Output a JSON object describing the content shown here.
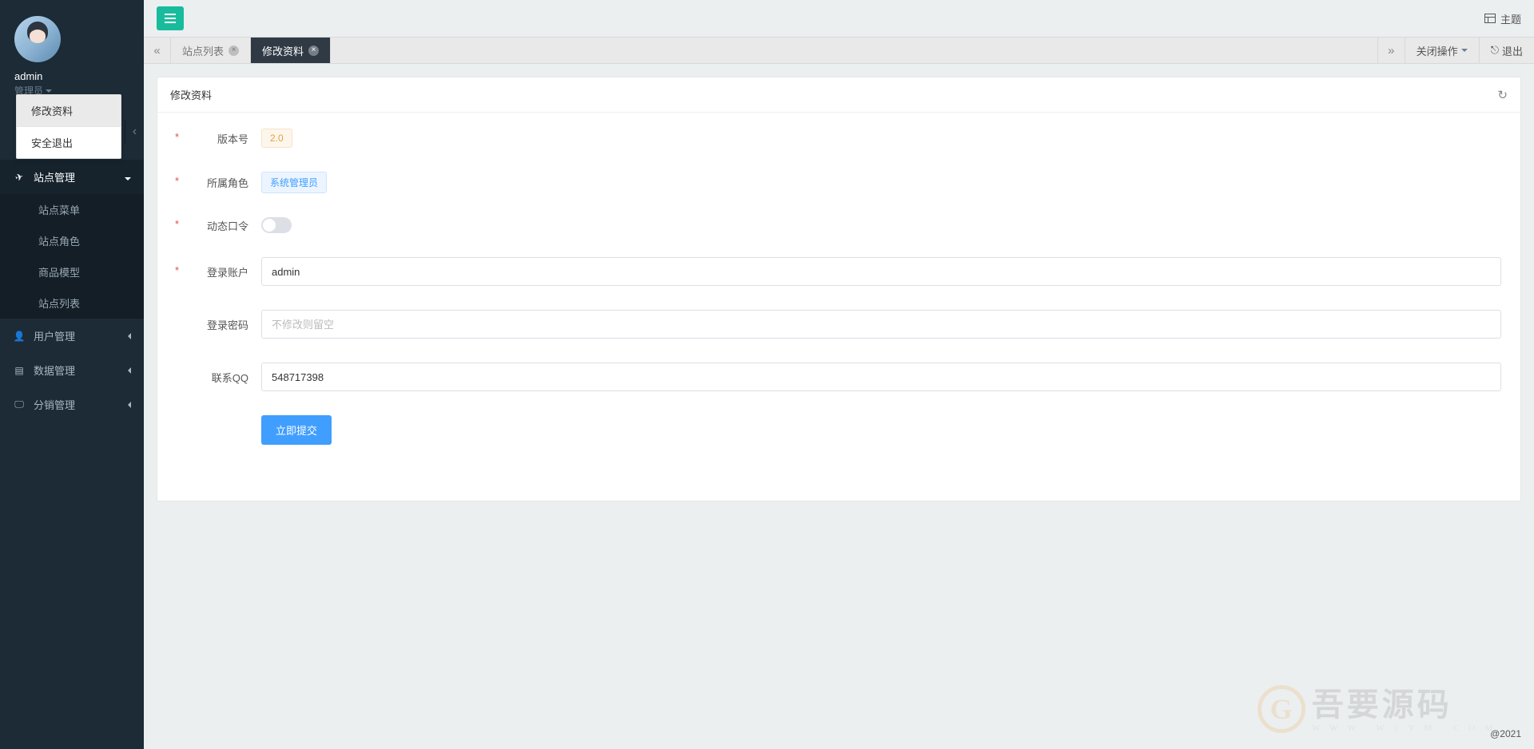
{
  "user": {
    "name": "admin",
    "role": "管理员"
  },
  "user_dropdown": {
    "items": [
      {
        "label": "修改资料",
        "active": true
      },
      {
        "label": "安全退出",
        "active": false
      }
    ]
  },
  "sidebar": {
    "menus": [
      {
        "icon": "send",
        "label": "站点管理",
        "open": true,
        "children": [
          {
            "label": "站点菜单"
          },
          {
            "label": "站点角色"
          },
          {
            "label": "商品模型"
          },
          {
            "label": "站点列表"
          }
        ]
      },
      {
        "icon": "user",
        "label": "用户管理",
        "open": false
      },
      {
        "icon": "db",
        "label": "数据管理",
        "open": false
      },
      {
        "icon": "desk",
        "label": "分销管理",
        "open": false
      }
    ]
  },
  "topbar": {
    "theme_label": "主题"
  },
  "tabs": {
    "items": [
      {
        "label": "站点列表",
        "active": false
      },
      {
        "label": "修改资料",
        "active": true
      }
    ],
    "close_ops_label": "关闭操作",
    "logout_label": "退出"
  },
  "panel": {
    "title": "修改资料",
    "form": {
      "version_label": "版本号",
      "version_value": "2.0",
      "role_label": "所属角色",
      "role_value": "系统管理员",
      "otp_label": "动态口令",
      "otp_on": false,
      "account_label": "登录账户",
      "account_value": "admin",
      "password_label": "登录密码",
      "password_placeholder": "不修改则留空",
      "qq_label": "联系QQ",
      "qq_value": "548717398",
      "submit_label": "立即提交"
    }
  },
  "footer": {
    "year": "@2021"
  },
  "watermark": {
    "cn": "吾要源码",
    "en": "WWW.W1YM.COM",
    "g": "G"
  }
}
